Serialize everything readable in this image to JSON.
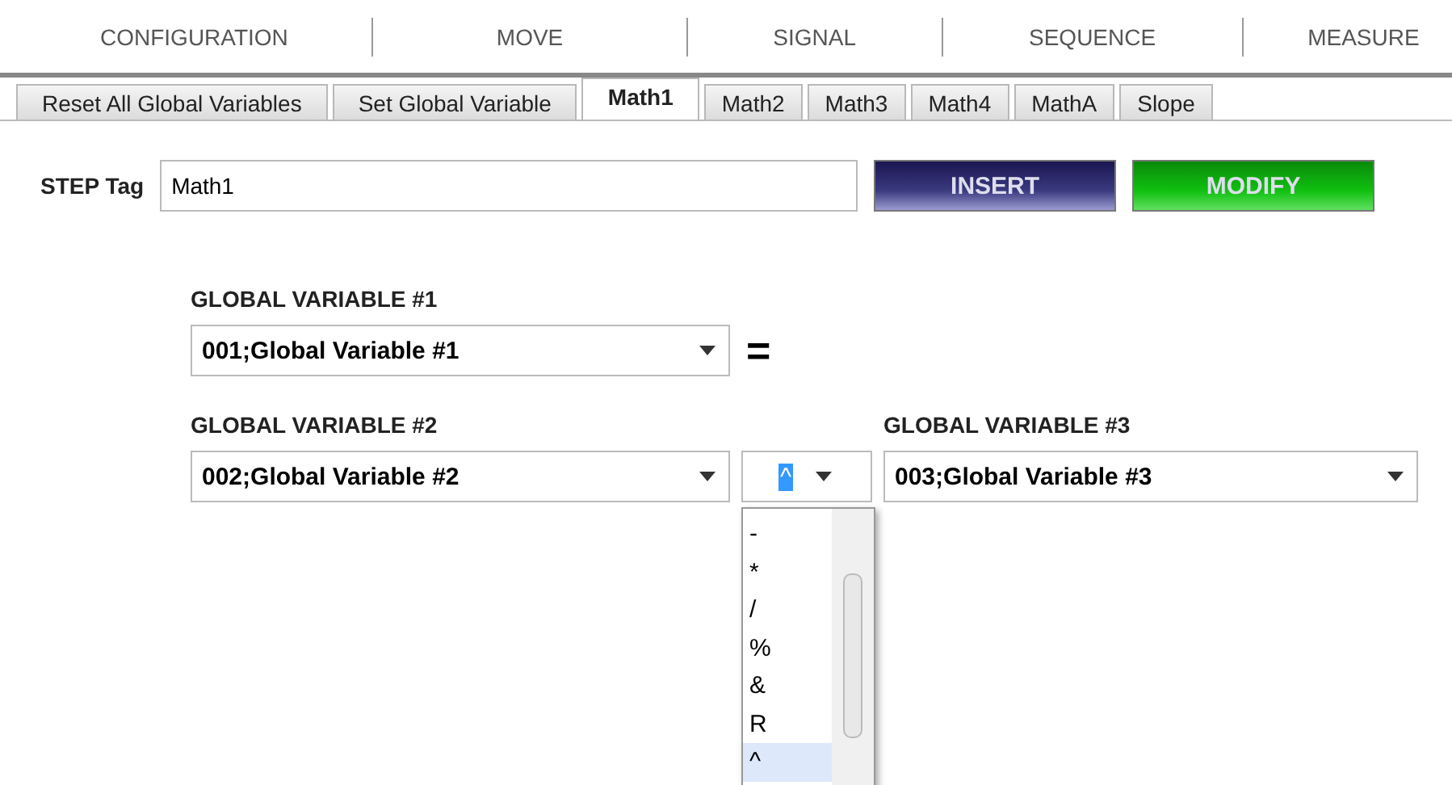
{
  "menu": [
    {
      "label": "CONFIGURATION",
      "selected": false
    },
    {
      "label": "MOVE",
      "selected": false
    },
    {
      "label": "SIGNAL",
      "selected": false
    },
    {
      "label": "SEQUENCE",
      "selected": false
    },
    {
      "label": "MEASURE",
      "selected": false
    }
  ],
  "tabs": [
    {
      "label": "Reset All Global Variables",
      "selected": false
    },
    {
      "label": "Set Global Variable",
      "selected": false
    },
    {
      "label": "Math1",
      "selected": true
    },
    {
      "label": "Math2",
      "selected": false
    },
    {
      "label": "Math3",
      "selected": false
    },
    {
      "label": "Math4",
      "selected": false
    },
    {
      "label": "MathA",
      "selected": false
    },
    {
      "label": "Slope",
      "selected": false
    }
  ],
  "step_tag": {
    "label": "STEP Tag",
    "value": "Math1"
  },
  "buttons": [
    {
      "label": "INSERT",
      "kind": "insert"
    },
    {
      "label": "MODIFY",
      "kind": "modify"
    }
  ],
  "variable_1": {
    "label": "GLOBAL VARIABLE  #1",
    "value": "001;Global Variable #1"
  },
  "equals": "=",
  "variable_2": {
    "label": "GLOBAL VARIABLE  #2",
    "value": "002;Global Variable #2"
  },
  "operator": {
    "value": "^",
    "expanded": true,
    "options": [
      {
        "label": "-",
        "selected": false
      },
      {
        "label": "*",
        "selected": false
      },
      {
        "label": "/",
        "selected": false
      },
      {
        "label": "%",
        "selected": false
      },
      {
        "label": "&",
        "selected": false
      },
      {
        "label": "R",
        "selected": false
      },
      {
        "label": "^",
        "selected": true
      }
    ]
  },
  "variable_3": {
    "label": "GLOBAL VARIABLE #3",
    "value": "003;Global Variable #3"
  }
}
